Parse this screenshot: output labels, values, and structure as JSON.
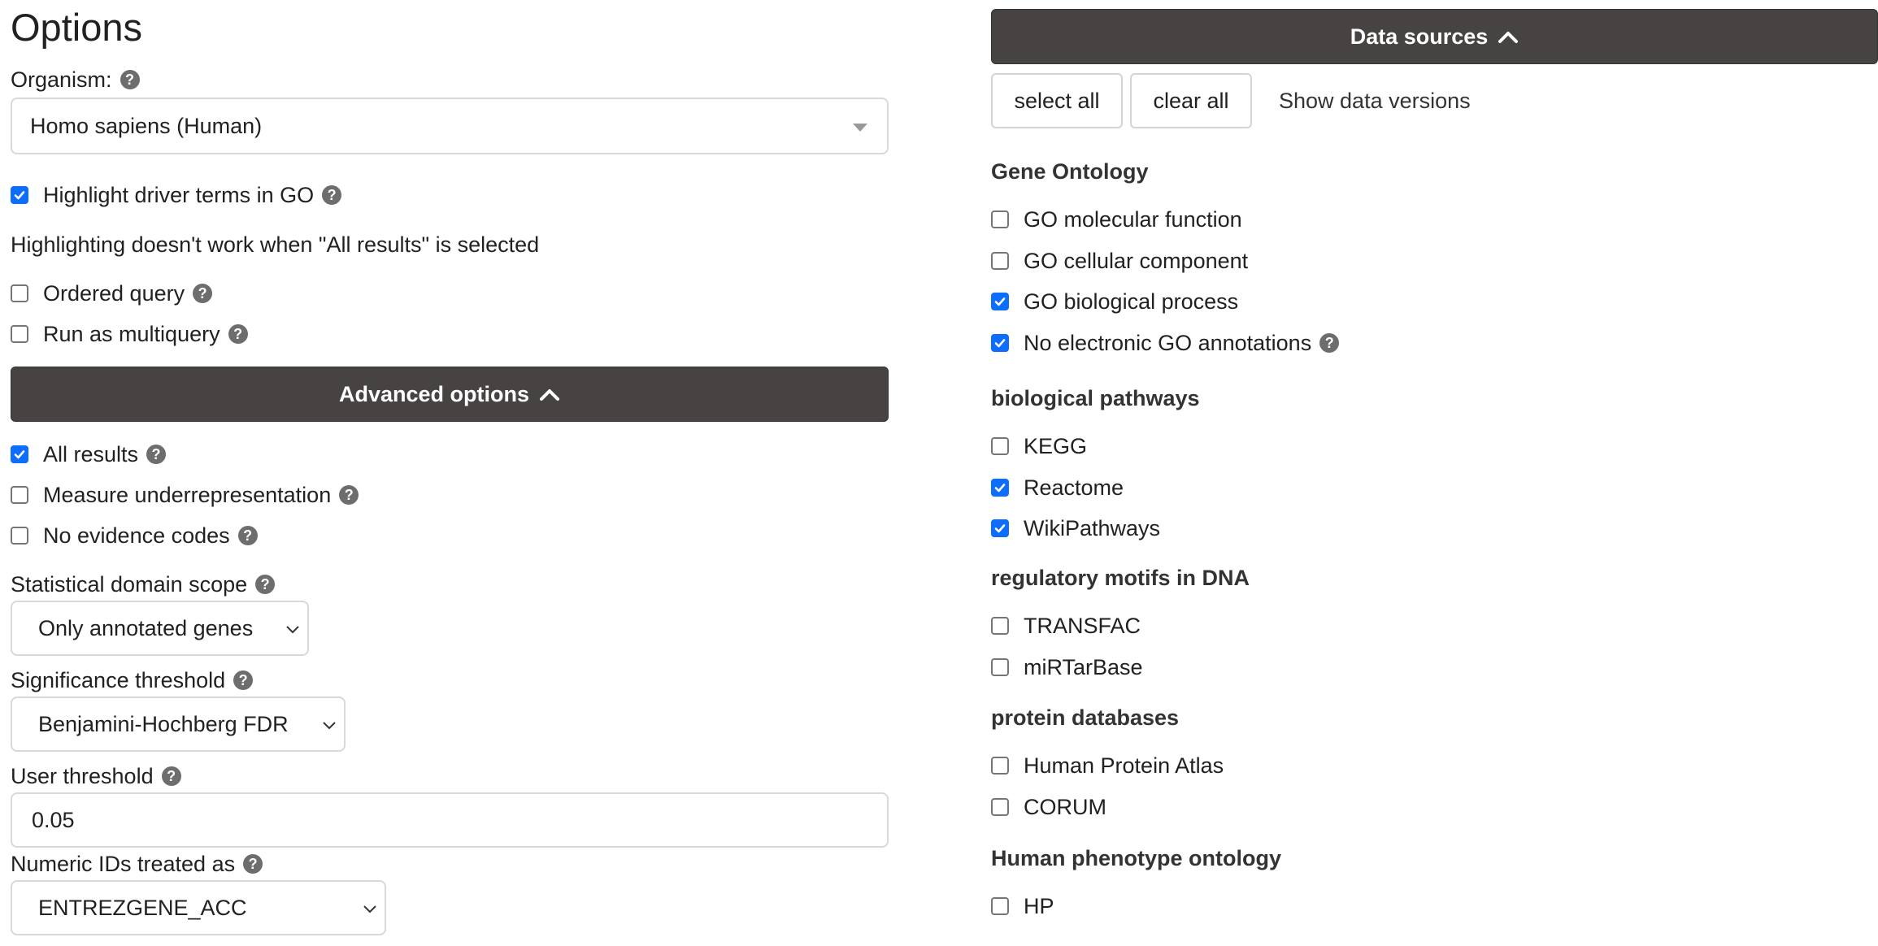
{
  "left": {
    "title": "Options",
    "organism": {
      "label": "Organism:",
      "value": "Homo sapiens (Human)"
    },
    "highlight_driver": {
      "label": "Highlight driver terms in GO",
      "checked": true
    },
    "highlight_note": "Highlighting doesn't work when \"All results\" is selected",
    "ordered_query": {
      "label": "Ordered query",
      "checked": false
    },
    "multiquery": {
      "label": "Run as multiquery",
      "checked": false
    },
    "advanced_bar": "Advanced options",
    "all_results": {
      "label": "All results",
      "checked": true
    },
    "underrep": {
      "label": "Measure underrepresentation",
      "checked": false
    },
    "no_evidence": {
      "label": "No evidence codes",
      "checked": false
    },
    "domain_scope": {
      "label": "Statistical domain scope",
      "value": "Only annotated genes"
    },
    "significance": {
      "label": "Significance threshold",
      "value": "Benjamini-Hochberg FDR"
    },
    "user_threshold": {
      "label": "User threshold",
      "value": "0.05"
    },
    "numeric_ids": {
      "label": "Numeric IDs treated as",
      "value": "ENTREZGENE_ACC"
    }
  },
  "right": {
    "data_sources_bar": "Data sources",
    "select_all": "select all",
    "clear_all": "clear all",
    "show_versions": "Show data versions",
    "sections": [
      {
        "title": "Gene Ontology",
        "items": [
          {
            "label": "GO molecular function",
            "checked": false
          },
          {
            "label": "GO cellular component",
            "checked": false
          },
          {
            "label": "GO biological process",
            "checked": true
          },
          {
            "label": "No electronic GO annotations",
            "checked": true
          }
        ]
      },
      {
        "title": "biological pathways",
        "items": [
          {
            "label": "KEGG",
            "checked": false
          },
          {
            "label": "Reactome",
            "checked": true
          },
          {
            "label": "WikiPathways",
            "checked": true
          }
        ]
      },
      {
        "title": "regulatory motifs in DNA",
        "items": [
          {
            "label": "TRANSFAC",
            "checked": false
          },
          {
            "label": "miRTarBase",
            "checked": false
          }
        ]
      },
      {
        "title": "protein databases",
        "items": [
          {
            "label": "Human Protein Atlas",
            "checked": false
          },
          {
            "label": "CORUM",
            "checked": false
          }
        ]
      },
      {
        "title": "Human phenotype ontology",
        "items": [
          {
            "label": "HP",
            "checked": false
          }
        ]
      }
    ]
  },
  "colors": {
    "accent": "#0d6efd",
    "bar": "#474343",
    "help": "#6d6d6d"
  },
  "icons": {
    "help": "question-circle-icon",
    "chevron_up": "chevron-up-icon",
    "chevron_down": "chevron-down-icon",
    "check": "check-icon"
  }
}
